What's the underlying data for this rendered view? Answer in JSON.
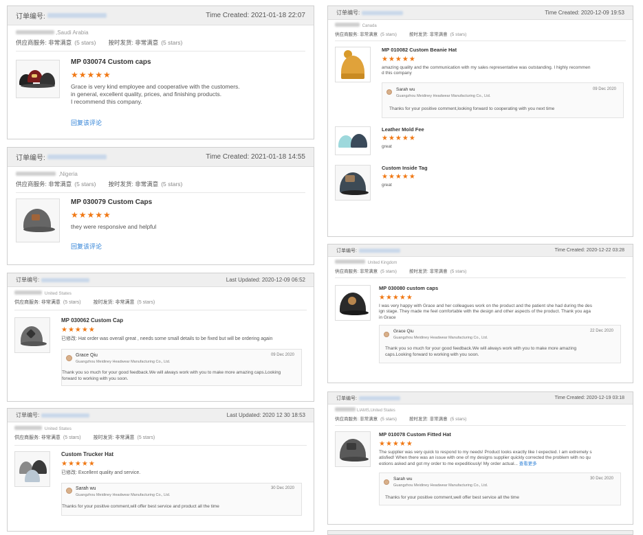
{
  "labels": {
    "order_no": "订单编号:",
    "time_created": "Time Created:",
    "last_updated": "Last Updated:",
    "supplier_service": "供应商服务:",
    "on_time": "按时发货:",
    "very_satisfied": "非常满意",
    "five_stars": "(5 stars)",
    "reply_link": "回复该评论",
    "view_more": "查看更多",
    "stars": "★★★★★"
  },
  "cards": [
    {
      "time_label": "Time Created:",
      "time": "2021-01-18 22:07",
      "buyer_suffix": ",Saudi Arabia",
      "title": "MP 030074 Custom caps",
      "text": "Grace is very kind employee and cooperative with the customers.\nin general, excellent quality, prices, and finishing products.\nI recommend this company.",
      "link": "回复该评论"
    },
    {
      "time_label": "Time Created:",
      "time": "2021-01-18 14:55",
      "buyer_suffix": " ,Nigeria",
      "title": "MP 030079 Custom Caps",
      "text": "they were responsive and helpful",
      "link": "回复该评论"
    },
    {
      "time_label": "Last Updated:",
      "time": "2020-12-09 06:52",
      "buyer_suffix": " United States",
      "title": "MP 030062 Custom Cap",
      "text": "已修改: Hat order was overall great , needs some small details to be fixed but will be ordering again",
      "reply": {
        "name": "Grace Qiu",
        "company": "Guangzhou Meidiney Headwear Manufacturing Co., Ltd.",
        "date": "09 Dec 2020",
        "text": "Thank you so much for your good feedback.We will always work with you to make more amazing caps.Looking forward to working with you soon."
      }
    },
    {
      "time_label": "Last Updated:",
      "time": "2020 12 30 18:53",
      "buyer_suffix": " United States",
      "title": "Custom Trucker Hat",
      "text": "已修改: Excellent quality and service.",
      "reply": {
        "name": "Sarah wu",
        "company": "Guangzhou Meidiney Headwear Manufacturing Co., Ltd.",
        "date": "30 Dec 2020",
        "text": "Thanks for your positive comment,will offer best service and product all the time"
      }
    },
    {
      "time_label": "Time Created:",
      "time": "2020-12-09 19:53",
      "buyer_suffix": " Canada",
      "title": "MP 010082 Custom Beanie Hat",
      "text": "amazing quality and the communication with my sales representative was outstanding. I highly recommen\nd this company",
      "reply": {
        "name": "Sarah wu",
        "company": "Guangzhou Meidiney Headwear Manufacturing Co., Ltd.",
        "date": "09 Dec 2020",
        "text": "Thanks for your positive comment,looking forward to cooperating with you next time"
      },
      "extra": [
        {
          "title": "Leather Mold Fee",
          "text": "great"
        },
        {
          "title": "Custom Inside Tag",
          "text": "great"
        }
      ]
    },
    {
      "time_label": "Time Created:",
      "time": "2020-12-22 03:28",
      "buyer_suffix": " United Kingdom",
      "title": "MP 030080 custom caps",
      "text": "I was very happy with Grace and her colleagues work on the product and the patient she had during the des\nign stage. They made me feel comfortable with the design and other aspects of the product. Thank you aga\nin Grace",
      "reply": {
        "name": "Grace Qiu",
        "company": "Guangzhou Meidiney Headwear Manufacturing Co., Ltd.",
        "date": "22 Dec 2020",
        "text": "Thank you so much for your good feedback.We will always work with you to make more amazing\ncaps.Looking forward to working with you soon."
      }
    },
    {
      "time_label": "Time Created:",
      "time": "2020-12-19 03:18",
      "buyer_suffix": "LIAMS,United States",
      "title": "MP 010078 Custom Fitted Hat",
      "text": "The supplier was very quick to respond to my needs! Product looks exactly like I expected. I am extremely s\natisfied! When there was an issue with one of my designs supplier quickly corrected the problem with no qu\nestions asked and got my order to me expeditiously! My order actual...",
      "more": "查看更多",
      "reply": {
        "name": "Sarah wu",
        "company": "Guangzhou Meidiney Headwear Manufacturing Co., Ltd.",
        "date": "30 Dec 2020",
        "text": "Thanks for your positive comment,well offer best service all the time"
      }
    }
  ],
  "colors": {
    "star": "#f07814",
    "link": "#2b7fd6",
    "header_bg": "#efefef"
  }
}
